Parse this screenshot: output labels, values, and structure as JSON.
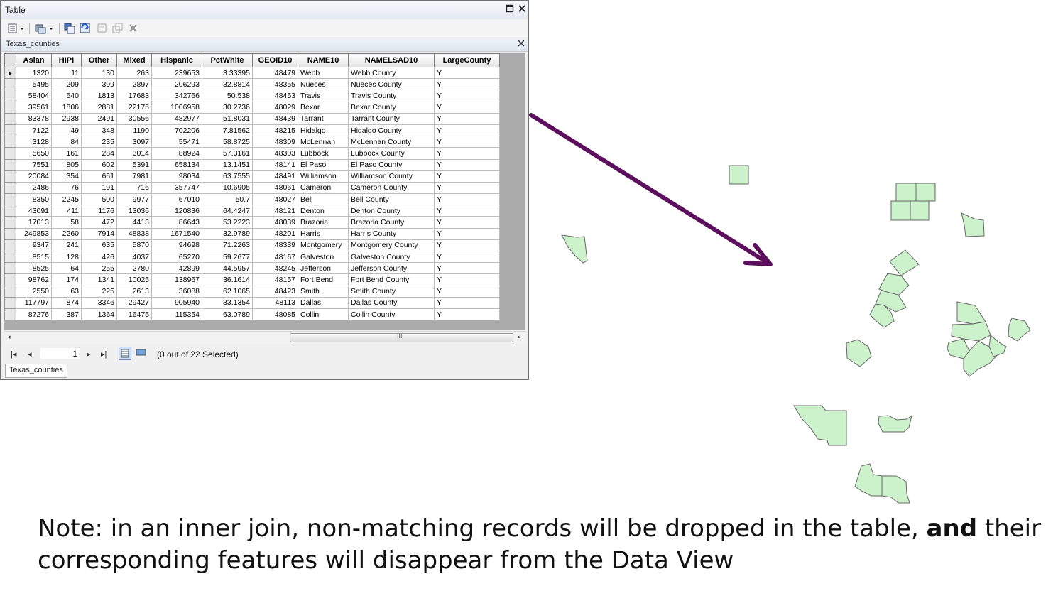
{
  "window": {
    "title": "Table"
  },
  "toolbar": {
    "icons": [
      "table-options-icon",
      "related-tables-icon",
      "select-by-attributes-icon",
      "switch-selection-icon",
      "clear-selection-icon",
      "zoom-to-selected-icon",
      "delete-selected-icon"
    ]
  },
  "layer_tab": {
    "title": "Texas_counties"
  },
  "table": {
    "columns": [
      "Asian",
      "HIPI",
      "Other",
      "Mixed",
      "Hispanic",
      "PctWhite",
      "GEOID10",
      "NAME10",
      "NAMELSAD10",
      "LargeCounty"
    ],
    "rows": [
      [
        "1320",
        "11",
        "130",
        "263",
        "239653",
        "3.33395",
        "48479",
        "Webb",
        "Webb County",
        "Y"
      ],
      [
        "5495",
        "209",
        "399",
        "2897",
        "206293",
        "32.8814",
        "48355",
        "Nueces",
        "Nueces County",
        "Y"
      ],
      [
        "58404",
        "540",
        "1813",
        "17683",
        "342766",
        "50.538",
        "48453",
        "Travis",
        "Travis County",
        "Y"
      ],
      [
        "39561",
        "1806",
        "2881",
        "22175",
        "1006958",
        "30.2736",
        "48029",
        "Bexar",
        "Bexar County",
        "Y"
      ],
      [
        "83378",
        "2938",
        "2491",
        "30556",
        "482977",
        "51.8031",
        "48439",
        "Tarrant",
        "Tarrant County",
        "Y"
      ],
      [
        "7122",
        "49",
        "348",
        "1190",
        "702206",
        "7.81562",
        "48215",
        "Hidalgo",
        "Hidalgo County",
        "Y"
      ],
      [
        "3128",
        "84",
        "235",
        "3097",
        "55471",
        "58.8725",
        "48309",
        "McLennan",
        "McLennan County",
        "Y"
      ],
      [
        "5650",
        "161",
        "284",
        "3014",
        "88924",
        "57.3161",
        "48303",
        "Lubbock",
        "Lubbock County",
        "Y"
      ],
      [
        "7551",
        "805",
        "602",
        "5391",
        "658134",
        "13.1451",
        "48141",
        "El Paso",
        "El Paso County",
        "Y"
      ],
      [
        "20084",
        "354",
        "661",
        "7981",
        "98034",
        "63.7555",
        "48491",
        "Williamson",
        "Williamson County",
        "Y"
      ],
      [
        "2486",
        "76",
        "191",
        "716",
        "357747",
        "10.6905",
        "48061",
        "Cameron",
        "Cameron County",
        "Y"
      ],
      [
        "8350",
        "2245",
        "500",
        "9977",
        "67010",
        "50.7",
        "48027",
        "Bell",
        "Bell County",
        "Y"
      ],
      [
        "43091",
        "411",
        "1176",
        "13036",
        "120836",
        "64.4247",
        "48121",
        "Denton",
        "Denton County",
        "Y"
      ],
      [
        "17013",
        "58",
        "472",
        "4413",
        "86643",
        "53.2223",
        "48039",
        "Brazoria",
        "Brazoria County",
        "Y"
      ],
      [
        "249853",
        "2260",
        "7914",
        "48838",
        "1671540",
        "32.9789",
        "48201",
        "Harris",
        "Harris County",
        "Y"
      ],
      [
        "9347",
        "241",
        "635",
        "5870",
        "94698",
        "71.2263",
        "48339",
        "Montgomery",
        "Montgomery County",
        "Y"
      ],
      [
        "8515",
        "128",
        "426",
        "4037",
        "65270",
        "59.2677",
        "48167",
        "Galveston",
        "Galveston County",
        "Y"
      ],
      [
        "8525",
        "64",
        "255",
        "2780",
        "42899",
        "44.5957",
        "48245",
        "Jefferson",
        "Jefferson County",
        "Y"
      ],
      [
        "98762",
        "174",
        "1341",
        "10025",
        "138967",
        "36.1614",
        "48157",
        "Fort Bend",
        "Fort Bend County",
        "Y"
      ],
      [
        "2550",
        "63",
        "225",
        "2613",
        "36088",
        "62.1065",
        "48423",
        "Smith",
        "Smith County",
        "Y"
      ],
      [
        "117797",
        "874",
        "3346",
        "29427",
        "905940",
        "33.1354",
        "48113",
        "Dallas",
        "Dallas County",
        "Y"
      ],
      [
        "87276",
        "387",
        "1364",
        "16475",
        "115354",
        "63.0789",
        "48085",
        "Collin",
        "Collin County",
        "Y"
      ]
    ]
  },
  "scrollbar": {
    "grip": "III"
  },
  "navigation": {
    "record_number": "1",
    "selection_status": "(0 out of 22 Selected)"
  },
  "bottom_tab": {
    "label": "Texas_counties"
  },
  "colors": {
    "county_fill": "#ccf2cc",
    "arrow": "#5c0f5c",
    "county_stroke": "#666666"
  },
  "note": {
    "part1": "Note: in an inner join, non-matching records will be dropped in the table, ",
    "bold": "and",
    "part2": " their corresponding features will disappear from the Data View"
  }
}
